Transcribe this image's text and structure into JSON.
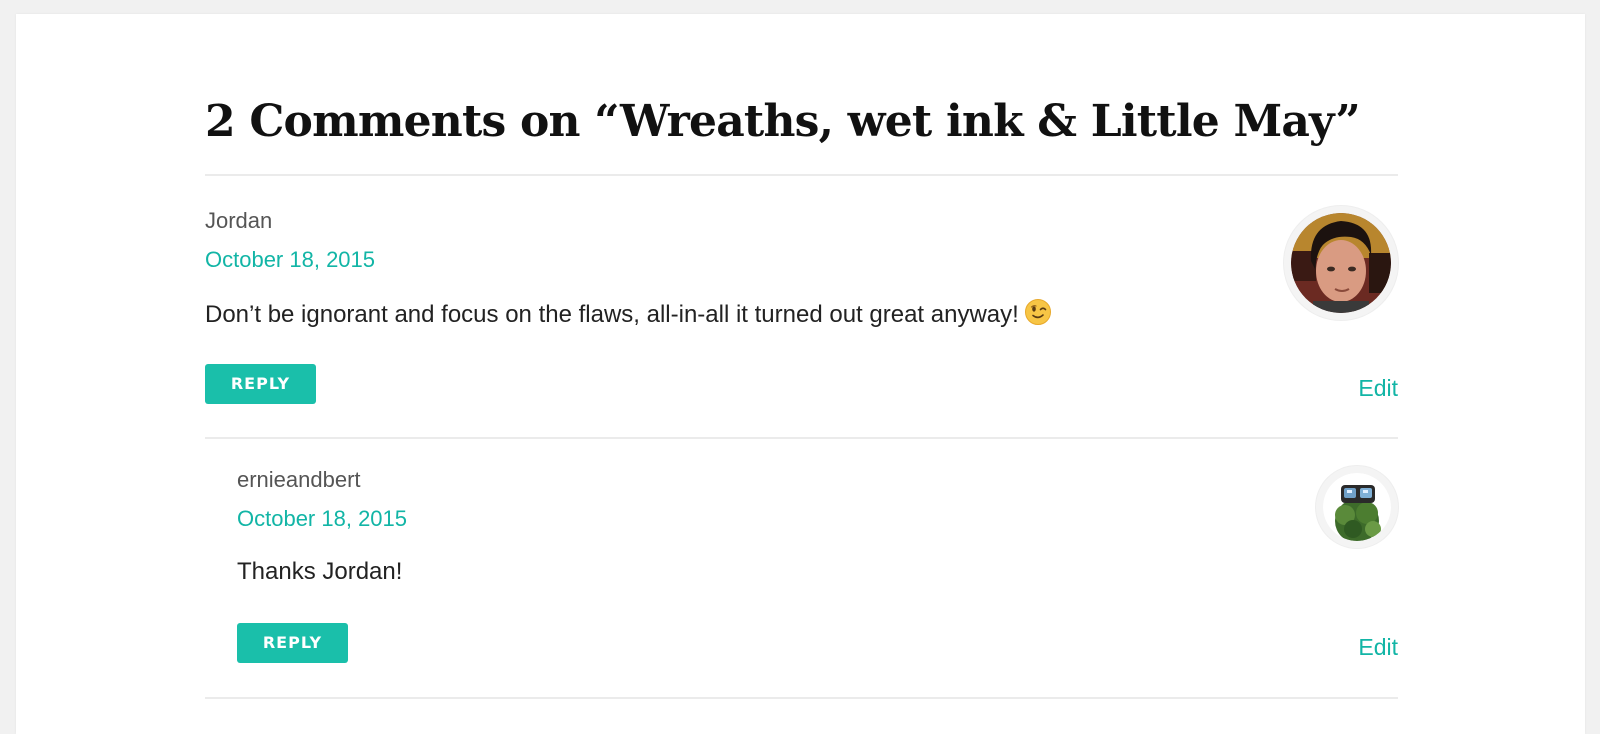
{
  "comments_section": {
    "title": "2 Comments on “Wreaths, wet ink & Little May”"
  },
  "comments": [
    {
      "author": "Jordan",
      "date": "October 18, 2015",
      "text": "Don’t be ignorant and focus on the flaws, all-in-all it turned out great anyway!",
      "emoji_icon": "winking-face-icon",
      "reply_label": "REPLY",
      "edit_label": "Edit",
      "avatar_icon": "user-photo-avatar"
    },
    {
      "author": "ernieandbert",
      "date": "October 18, 2015",
      "text": "Thanks Jordan!",
      "reply_label": "REPLY",
      "edit_label": "Edit",
      "avatar_icon": "user-photo-avatar"
    }
  ],
  "colors": {
    "accent": "#1abfaa",
    "link": "#12b5a6",
    "heading": "#111111",
    "divider": "#ebebeb",
    "page_background": "#f1f1f1"
  }
}
